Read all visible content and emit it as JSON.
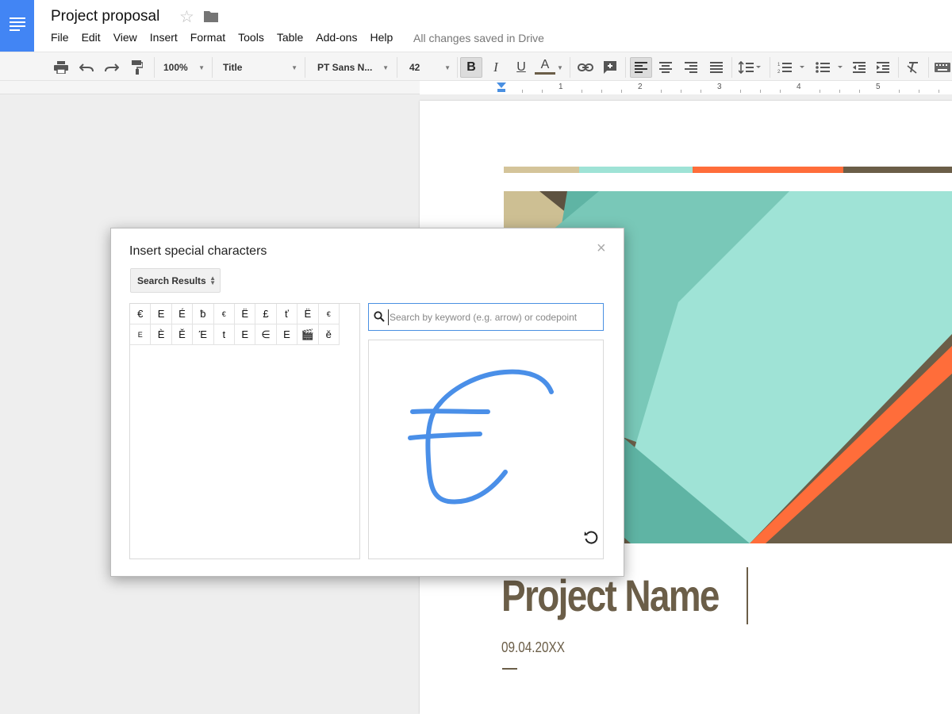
{
  "header": {
    "doc_title": "Project proposal",
    "saved_status": "All changes saved in Drive",
    "menu": [
      "File",
      "Edit",
      "View",
      "Insert",
      "Format",
      "Tools",
      "Table",
      "Add-ons",
      "Help"
    ]
  },
  "toolbar": {
    "zoom": "100%",
    "style": "Title",
    "font": "PT Sans N...",
    "font_size": "42",
    "bold_label": "B",
    "italic_label": "I",
    "underline_label": "U",
    "text_color_label": "A"
  },
  "ruler": {
    "marks": [
      "1",
      "2",
      "3",
      "4",
      "5"
    ]
  },
  "document": {
    "project_name": "Project Name",
    "date": "09.04.20XX"
  },
  "dialog": {
    "title": "Insert special characters",
    "close_label": "×",
    "category": "Search Results",
    "search_placeholder": "Search by keyword (e.g. arrow) or codepoint",
    "search_value": "",
    "characters": [
      [
        "€",
        "E",
        "É",
        "ƀ",
        "€",
        "Ë",
        "£",
        "ť",
        "Ë",
        "€"
      ],
      [
        "E",
        "È",
        "Ě",
        "Έ",
        "t",
        "E",
        "∈",
        "E",
        "🎬",
        "ě"
      ]
    ]
  },
  "colors": {
    "brand_blue": "#4285f4",
    "title_brown": "#6b5e48",
    "strip": [
      "#d4c49a",
      "#9fe3d6",
      "#ff6d3a",
      "#6b5e48"
    ],
    "ink_blue": "#4a8fe8"
  }
}
